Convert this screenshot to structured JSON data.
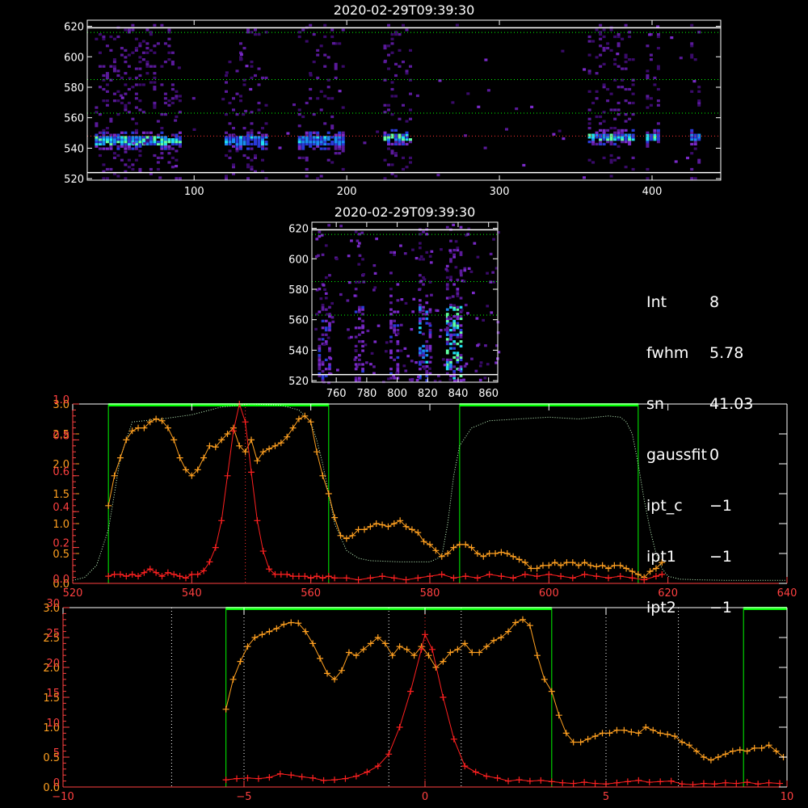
{
  "info_panel": [
    {
      "key": "Int",
      "value": "8"
    },
    {
      "key": "fwhm",
      "value": "5.78"
    },
    {
      "key": "sn",
      "value": "41.03"
    },
    {
      "key": "gaussfit",
      "value": "0"
    },
    {
      "key": "ipt_c",
      "value": "−1"
    },
    {
      "key": "ipt1",
      "value": "−1"
    },
    {
      "key": "ipt2",
      "value": "−1"
    }
  ],
  "chart_data": [
    {
      "type": "heatmap",
      "title": "2020-02-29T09:39:30",
      "xlim": [
        30,
        445
      ],
      "ylim": [
        519,
        624
      ],
      "xticks": [
        100,
        200,
        300,
        400
      ],
      "yticks": [
        520,
        540,
        560,
        580,
        600,
        620
      ],
      "hlines_white": [
        619,
        524
      ],
      "hlines_green_dotted": [
        616,
        585,
        563
      ],
      "hline_red_dotted": 548,
      "bands": [
        {
          "x": [
            35,
            92
          ],
          "peak": 546,
          "strength": 0.9
        },
        {
          "x": [
            120,
            148
          ],
          "peak": 546,
          "strength": 0.6
        },
        {
          "x": [
            168,
            197
          ],
          "peak": 546,
          "strength": 0.55
        },
        {
          "x": [
            224,
            243
          ],
          "peak": 548,
          "strength": 1.0
        },
        {
          "x": [
            358,
            388
          ],
          "peak": 548,
          "strength": 0.9
        },
        {
          "x": [
            396,
            405
          ],
          "peak": 548,
          "strength": 0.9
        },
        {
          "x": [
            425,
            430
          ],
          "peak": 548,
          "strength": 0.6
        }
      ],
      "colors": {
        "axis": "#ffffff",
        "green": "#00ff00",
        "red": "#ff0000"
      }
    },
    {
      "type": "heatmap",
      "title": "2020-02-29T09:39:30",
      "xlim": [
        744,
        866
      ],
      "ylim": [
        519,
        624
      ],
      "xticks": [
        760,
        780,
        800,
        820,
        840,
        860
      ],
      "yticks": [
        520,
        540,
        560,
        580,
        600,
        620
      ],
      "hlines_white": [
        619,
        524
      ],
      "hlines_green_dotted": [
        616,
        585,
        563
      ],
      "bands": [
        {
          "x": [
            748,
            756
          ],
          "strength": 0.5
        },
        {
          "x": [
            772,
            778
          ],
          "strength": 0.4
        },
        {
          "x": [
            795,
            800
          ],
          "strength": 0.45
        },
        {
          "x": [
            814,
            822
          ],
          "strength": 0.7
        },
        {
          "x": [
            832,
            842
          ],
          "strength": 1.0
        }
      ]
    },
    {
      "type": "line",
      "xlim": [
        520,
        640
      ],
      "xticks": [
        520,
        540,
        560,
        580,
        600,
        620,
        640
      ],
      "left_axis_orange": {
        "ylim": [
          0,
          3.0
        ],
        "ticks": [
          "0.0",
          "0.5",
          "1.0",
          "1.5",
          "2.0",
          "2.5",
          "3.0"
        ]
      },
      "left_axis_red": {
        "ylim": [
          0,
          1.0
        ],
        "ticks": [
          "0.0",
          "0.2",
          "0.4",
          "0.6",
          "0.8",
          "1.0"
        ]
      },
      "green_boxes": [
        [
          526,
          563
        ],
        [
          585,
          615
        ]
      ],
      "red_dotted_vline": 549,
      "dotted_filter_curve": {
        "x": [
          520,
          522,
          524,
          526,
          527,
          528,
          530,
          535,
          540,
          545,
          550,
          555,
          558,
          560,
          561,
          562,
          563,
          564,
          566,
          568,
          570,
          575,
          580,
          582,
          583,
          584,
          585,
          587,
          590,
          595,
          600,
          605,
          610,
          612,
          613,
          614,
          615,
          616,
          617,
          618,
          619,
          620,
          622,
          625,
          630,
          635,
          640
        ],
        "y": [
          0.05,
          0.1,
          0.3,
          0.9,
          1.5,
          2.1,
          2.7,
          2.75,
          2.82,
          2.95,
          3.0,
          2.98,
          2.9,
          2.7,
          2.4,
          2.0,
          1.5,
          1.0,
          0.55,
          0.42,
          0.38,
          0.36,
          0.36,
          0.45,
          1.0,
          1.8,
          2.3,
          2.6,
          2.72,
          2.75,
          2.78,
          2.75,
          2.8,
          2.78,
          2.7,
          2.5,
          2.0,
          1.4,
          0.9,
          0.5,
          0.25,
          0.12,
          0.07,
          0.06,
          0.05,
          0.05,
          0.05
        ]
      },
      "series": [
        {
          "color": "#ffa020",
          "x": [
            526,
            527,
            528,
            529,
            530,
            531,
            532,
            533,
            534,
            535,
            536,
            537,
            538,
            539,
            540,
            541,
            542,
            543,
            544,
            545,
            546,
            547,
            548,
            549,
            550,
            551,
            552,
            553,
            554,
            555,
            556,
            557,
            558,
            559,
            560,
            561,
            562,
            563,
            564,
            565,
            566,
            567,
            568,
            569,
            570,
            571,
            572,
            573,
            574,
            575,
            576,
            577,
            578,
            579,
            580,
            581,
            582,
            583,
            584,
            585,
            586,
            587,
            588,
            589,
            590,
            591,
            592,
            593,
            594,
            595,
            596,
            597,
            598,
            599,
            600,
            601,
            602,
            603,
            604,
            605,
            606,
            607,
            608,
            609,
            610,
            611,
            612,
            613,
            614,
            615,
            616,
            617,
            618,
            619
          ],
          "y": [
            1.3,
            1.8,
            2.1,
            2.4,
            2.55,
            2.6,
            2.6,
            2.7,
            2.75,
            2.72,
            2.6,
            2.4,
            2.1,
            1.9,
            1.8,
            1.9,
            2.1,
            2.3,
            2.28,
            2.4,
            2.5,
            2.6,
            2.3,
            2.2,
            2.4,
            2.05,
            2.2,
            2.25,
            2.3,
            2.35,
            2.45,
            2.6,
            2.75,
            2.8,
            2.7,
            2.2,
            1.8,
            1.5,
            1.1,
            0.8,
            0.75,
            0.8,
            0.9,
            0.9,
            0.95,
            1.0,
            0.98,
            0.95,
            1.0,
            1.05,
            0.95,
            0.9,
            0.85,
            0.7,
            0.65,
            0.55,
            0.45,
            0.5,
            0.6,
            0.65,
            0.65,
            0.6,
            0.5,
            0.45,
            0.5,
            0.5,
            0.52,
            0.5,
            0.45,
            0.4,
            0.35,
            0.25,
            0.25,
            0.3,
            0.3,
            0.35,
            0.3,
            0.35,
            0.35,
            0.3,
            0.35,
            0.3,
            0.28,
            0.3,
            0.25,
            0.3,
            0.3,
            0.25,
            0.2,
            0.15,
            0.1,
            0.2,
            0.25,
            0.35
          ]
        },
        {
          "color": "#ff2020",
          "x": [
            526,
            527,
            528,
            529,
            530,
            531,
            532,
            533,
            534,
            535,
            536,
            537,
            538,
            539,
            540,
            541,
            542,
            543,
            544,
            545,
            546,
            547,
            548,
            549,
            550,
            551,
            552,
            553,
            554,
            555,
            556,
            557,
            558,
            559,
            560,
            561,
            562,
            563,
            564,
            566,
            568,
            570,
            572,
            574,
            576,
            578,
            580,
            582,
            584,
            586,
            588,
            590,
            592,
            594,
            596,
            598,
            600,
            602,
            604,
            606,
            608,
            610,
            612,
            614,
            616,
            618,
            619
          ],
          "y": [
            0.04,
            0.05,
            0.05,
            0.04,
            0.05,
            0.04,
            0.06,
            0.08,
            0.06,
            0.04,
            0.06,
            0.05,
            0.04,
            0.03,
            0.05,
            0.05,
            0.07,
            0.12,
            0.2,
            0.35,
            0.6,
            0.85,
            1.0,
            0.9,
            0.62,
            0.35,
            0.18,
            0.08,
            0.05,
            0.05,
            0.05,
            0.04,
            0.04,
            0.04,
            0.03,
            0.04,
            0.03,
            0.04,
            0.03,
            0.03,
            0.02,
            0.03,
            0.04,
            0.03,
            0.02,
            0.03,
            0.04,
            0.05,
            0.03,
            0.04,
            0.03,
            0.05,
            0.04,
            0.03,
            0.05,
            0.04,
            0.05,
            0.04,
            0.03,
            0.05,
            0.04,
            0.03,
            0.04,
            0.03,
            0.02,
            0.04,
            0.05
          ]
        }
      ]
    },
    {
      "type": "line",
      "xlim": [
        -10,
        10
      ],
      "xticks": [
        -10,
        -5,
        0,
        5,
        10
      ],
      "left_axis_orange": {
        "ylim": [
          0,
          3.0
        ],
        "ticks": [
          "0.0",
          "0.5",
          "1.0",
          "1.5",
          "2.0",
          "2.5",
          "3.0"
        ]
      },
      "left_axis_red": {
        "ylim": [
          0,
          30
        ],
        "ticks": [
          "0",
          "5",
          "10",
          "15",
          "20",
          "25",
          "30"
        ]
      },
      "green_boxes": [
        [
          -5.5,
          3.5
        ],
        [
          8.8,
          10.5
        ]
      ],
      "dotted_vlines_white": [
        -7,
        -5,
        -1,
        1,
        5,
        7
      ],
      "red_dotted_vline": 0,
      "series": [
        {
          "color": "#ffa020",
          "x": [
            -5.5,
            -5.3,
            -5.1,
            -4.9,
            -4.7,
            -4.5,
            -4.3,
            -4.1,
            -3.9,
            -3.7,
            -3.5,
            -3.3,
            -3.1,
            -2.9,
            -2.7,
            -2.5,
            -2.3,
            -2.1,
            -1.9,
            -1.7,
            -1.5,
            -1.3,
            -1.1,
            -0.9,
            -0.7,
            -0.5,
            -0.3,
            -0.1,
            0.1,
            0.3,
            0.5,
            0.7,
            0.9,
            1.1,
            1.3,
            1.5,
            1.7,
            1.9,
            2.1,
            2.3,
            2.5,
            2.7,
            2.9,
            3.1,
            3.3,
            3.5,
            3.7,
            3.9,
            4.1,
            4.3,
            4.5,
            4.7,
            4.9,
            5.1,
            5.3,
            5.5,
            5.7,
            5.9,
            6.1,
            6.3,
            6.5,
            6.7,
            6.9,
            7.1,
            7.3,
            7.5,
            7.7,
            7.9,
            8.1,
            8.3,
            8.5,
            8.7,
            8.9,
            9.1,
            9.3,
            9.5,
            9.7,
            9.9
          ],
          "y": [
            1.3,
            1.8,
            2.1,
            2.35,
            2.5,
            2.55,
            2.6,
            2.65,
            2.72,
            2.75,
            2.74,
            2.6,
            2.4,
            2.15,
            1.9,
            1.8,
            1.95,
            2.25,
            2.2,
            2.3,
            2.4,
            2.5,
            2.4,
            2.2,
            2.35,
            2.3,
            2.2,
            2.35,
            2.2,
            2.0,
            2.1,
            2.25,
            2.3,
            2.4,
            2.25,
            2.25,
            2.35,
            2.45,
            2.5,
            2.6,
            2.75,
            2.8,
            2.7,
            2.2,
            1.8,
            1.6,
            1.2,
            0.9,
            0.75,
            0.75,
            0.8,
            0.85,
            0.9,
            0.9,
            0.95,
            0.95,
            0.92,
            0.9,
            1.0,
            0.95,
            0.9,
            0.88,
            0.85,
            0.75,
            0.7,
            0.6,
            0.5,
            0.45,
            0.5,
            0.55,
            0.6,
            0.62,
            0.6,
            0.65,
            0.65,
            0.7,
            0.6,
            0.5
          ]
        },
        {
          "color": "#ff2020",
          "x": [
            -5.5,
            -5.2,
            -4.9,
            -4.6,
            -4.3,
            -4.0,
            -3.7,
            -3.4,
            -3.1,
            -2.8,
            -2.5,
            -2.2,
            -1.9,
            -1.6,
            -1.3,
            -1.0,
            -0.7,
            -0.4,
            -0.1,
            0.0,
            0.2,
            0.5,
            0.8,
            1.1,
            1.4,
            1.7,
            2.0,
            2.3,
            2.6,
            2.9,
            3.2,
            3.5,
            3.8,
            4.1,
            4.4,
            4.7,
            5.0,
            5.3,
            5.6,
            5.9,
            6.2,
            6.5,
            6.8,
            7.1,
            7.4,
            7.7,
            8.0,
            8.3,
            8.6,
            8.9,
            9.2,
            9.5,
            9.8
          ],
          "y": [
            1.2,
            1.4,
            1.5,
            1.4,
            1.6,
            2.2,
            2.0,
            1.7,
            1.5,
            1.1,
            1.2,
            1.4,
            1.8,
            2.5,
            3.5,
            5.5,
            10,
            16,
            23,
            25.5,
            23,
            15,
            8,
            3.5,
            2.5,
            1.8,
            1.5,
            1.0,
            1.2,
            1.0,
            1.1,
            0.9,
            0.7,
            0.6,
            0.8,
            0.6,
            0.5,
            0.7,
            0.9,
            1.1,
            0.8,
            0.9,
            1.0,
            0.5,
            0.4,
            0.6,
            0.5,
            0.7,
            0.6,
            0.8,
            0.5,
            0.7,
            0.6
          ]
        }
      ]
    }
  ]
}
